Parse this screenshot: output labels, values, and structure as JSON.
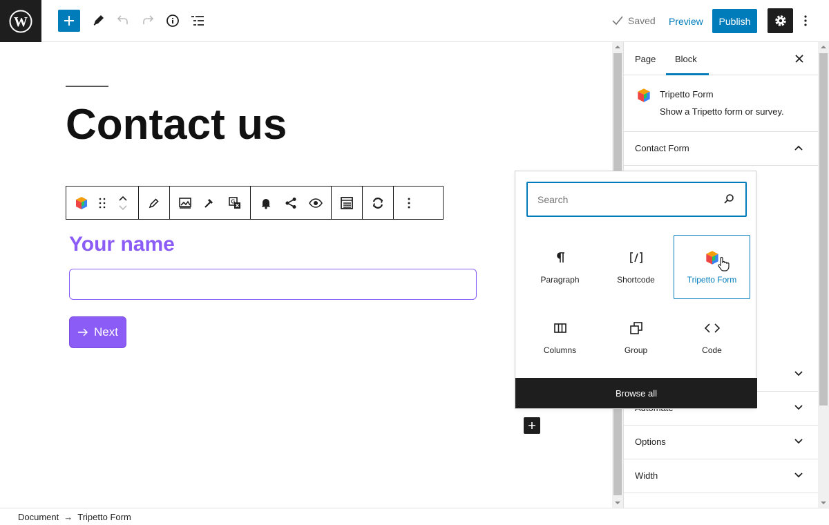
{
  "topbar": {
    "saved_label": "Saved",
    "preview_label": "Preview",
    "publish_label": "Publish"
  },
  "editor": {
    "page_title": "Contact us",
    "field_label": "Your name",
    "next_label": "Next"
  },
  "inserter": {
    "search_placeholder": "Search",
    "blocks": [
      {
        "label": "Paragraph",
        "icon": "paragraph-icon"
      },
      {
        "label": "Shortcode",
        "icon": "shortcode-icon"
      },
      {
        "label": "Tripetto Form",
        "icon": "tripetto-icon",
        "selected": true
      },
      {
        "label": "Columns",
        "icon": "columns-icon"
      },
      {
        "label": "Group",
        "icon": "group-icon"
      },
      {
        "label": "Code",
        "icon": "code-icon"
      }
    ],
    "browse_all_label": "Browse all"
  },
  "sidebar": {
    "tabs": [
      {
        "label": "Page"
      },
      {
        "label": "Block",
        "active": true
      }
    ],
    "block_card": {
      "name": "Tripetto Form",
      "description": "Show a Tripetto form or survey."
    },
    "panels": [
      {
        "title": "Contact Form",
        "open": true
      },
      {
        "title": "Automate"
      },
      {
        "title": "Options"
      },
      {
        "title": "Width"
      }
    ]
  },
  "footer": {
    "crumb_root": "Document",
    "separator": "→",
    "crumb_leaf": "Tripetto Form"
  },
  "colors": {
    "accent": "#007cba",
    "form_purple": "#8b5cf6",
    "dark": "#1e1e1e"
  }
}
